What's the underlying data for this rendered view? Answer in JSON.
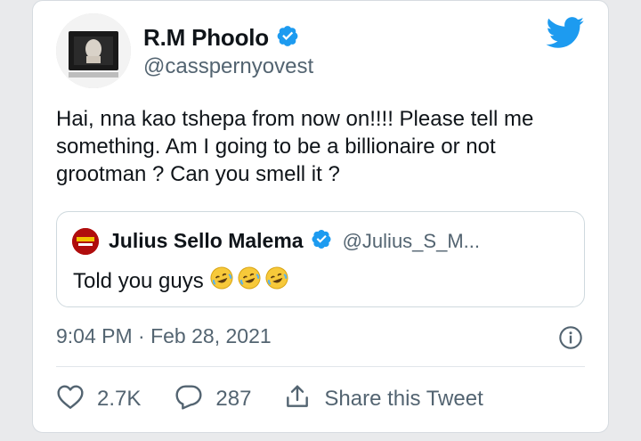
{
  "tweet": {
    "author_name": "R.M Phoolo",
    "author_handle": "@casspernyovest",
    "text": "Hai, nna kao tshepa from now on!!!! Please tell me something. Am I going to be a billionaire or not grootman ? Can you smell it ?",
    "timestamp": "9:04 PM · Feb 28, 2021"
  },
  "quoted_tweet": {
    "author_name": "Julius Sello Malema",
    "author_handle": "@Julius_S_M...",
    "text": "Told you guys",
    "emoji_count": 3
  },
  "actions": {
    "likes": "2.7K",
    "replies": "287",
    "share_label": "Share this Tweet"
  },
  "colors": {
    "twitter_blue": "#1d9bf0",
    "secondary_text": "#536471"
  },
  "icons": [
    "twitter-bird-icon",
    "verified-badge-icon",
    "info-icon",
    "heart-icon",
    "reply-bubble-icon",
    "share-icon",
    "laughing-emoji-icon"
  ]
}
